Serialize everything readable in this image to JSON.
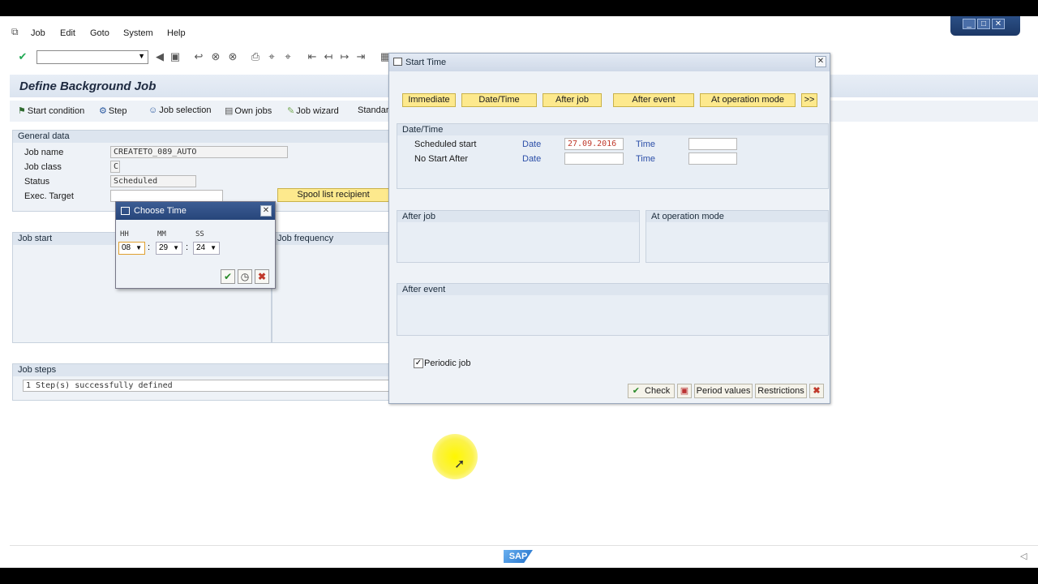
{
  "menu": {
    "items": [
      "Job",
      "Edit",
      "Goto",
      "System",
      "Help"
    ]
  },
  "window_controls": {
    "minimize": "_",
    "maximize": "□",
    "close": "✕"
  },
  "page": {
    "title": "Define Background Job"
  },
  "app_toolbar": {
    "start_condition": "Start condition",
    "step": "Step",
    "job_selection": "Job selection",
    "own_jobs": "Own jobs",
    "job_wizard": "Job wizard",
    "standard": "Standard"
  },
  "general_data": {
    "header": "General data",
    "job_name_label": "Job name",
    "job_name_value": "CREATETO_089_AUTO",
    "job_class_label": "Job class",
    "job_class_value": "C",
    "status_label": "Status",
    "status_value": "Scheduled",
    "exec_target_label": "Exec. Target",
    "exec_target_value": "",
    "spool_button": "Spool list recipient"
  },
  "job_start": {
    "header": "Job start"
  },
  "job_frequency": {
    "header": "Job frequency"
  },
  "job_steps": {
    "header": "Job steps",
    "message": "1 Step(s) successfully defined"
  },
  "start_time_dialog": {
    "title": "Start Time",
    "buttons": {
      "immediate": "Immediate",
      "date_time": "Date/Time",
      "after_job": "After job",
      "after_event": "After event",
      "at_operation_mode": "At operation mode",
      "more": ">>"
    },
    "date_time_group": {
      "header": "Date/Time",
      "scheduled_start_label": "Scheduled start",
      "no_start_after_label": "No Start After",
      "date_label": "Date",
      "time_label": "Time",
      "scheduled_date": "27.09.2016",
      "scheduled_time": "",
      "no_start_date": "",
      "no_start_time": ""
    },
    "after_job_header": "After job",
    "at_operation_mode_header": "At operation mode",
    "after_event_header": "After event",
    "periodic_job_label": "Periodic job",
    "periodic_job_checked": true,
    "bottom": {
      "check": "Check",
      "period_values": "Period values",
      "restrictions": "Restrictions"
    }
  },
  "choose_time_dialog": {
    "title": "Choose Time",
    "hh_label": "HH",
    "mm_label": "MM",
    "ss_label": "SS",
    "hh": "08",
    "mm": "29",
    "ss": "24",
    "separator": ":"
  },
  "statusbar": {
    "logo": "SAP"
  },
  "colors": {
    "accent_yellow": "#fde98d",
    "dialog_bg": "#eef2f7",
    "title_blue": "#27457a",
    "date_red": "#c0392b"
  }
}
